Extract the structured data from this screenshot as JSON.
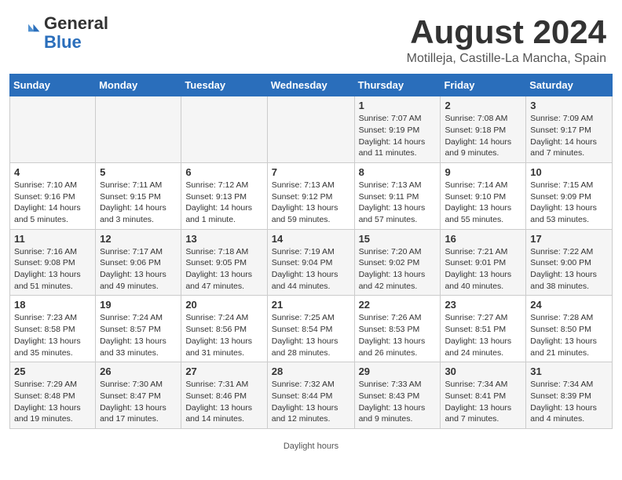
{
  "header": {
    "logo_general": "General",
    "logo_blue": "Blue",
    "month_title": "August 2024",
    "location": "Motilleja, Castille-La Mancha, Spain"
  },
  "days_of_week": [
    "Sunday",
    "Monday",
    "Tuesday",
    "Wednesday",
    "Thursday",
    "Friday",
    "Saturday"
  ],
  "weeks": [
    [
      {
        "day": "",
        "info": ""
      },
      {
        "day": "",
        "info": ""
      },
      {
        "day": "",
        "info": ""
      },
      {
        "day": "",
        "info": ""
      },
      {
        "day": "1",
        "info": "Sunrise: 7:07 AM\nSunset: 9:19 PM\nDaylight: 14 hours and 11 minutes."
      },
      {
        "day": "2",
        "info": "Sunrise: 7:08 AM\nSunset: 9:18 PM\nDaylight: 14 hours and 9 minutes."
      },
      {
        "day": "3",
        "info": "Sunrise: 7:09 AM\nSunset: 9:17 PM\nDaylight: 14 hours and 7 minutes."
      }
    ],
    [
      {
        "day": "4",
        "info": "Sunrise: 7:10 AM\nSunset: 9:16 PM\nDaylight: 14 hours and 5 minutes."
      },
      {
        "day": "5",
        "info": "Sunrise: 7:11 AM\nSunset: 9:15 PM\nDaylight: 14 hours and 3 minutes."
      },
      {
        "day": "6",
        "info": "Sunrise: 7:12 AM\nSunset: 9:13 PM\nDaylight: 14 hours and 1 minute."
      },
      {
        "day": "7",
        "info": "Sunrise: 7:13 AM\nSunset: 9:12 PM\nDaylight: 13 hours and 59 minutes."
      },
      {
        "day": "8",
        "info": "Sunrise: 7:13 AM\nSunset: 9:11 PM\nDaylight: 13 hours and 57 minutes."
      },
      {
        "day": "9",
        "info": "Sunrise: 7:14 AM\nSunset: 9:10 PM\nDaylight: 13 hours and 55 minutes."
      },
      {
        "day": "10",
        "info": "Sunrise: 7:15 AM\nSunset: 9:09 PM\nDaylight: 13 hours and 53 minutes."
      }
    ],
    [
      {
        "day": "11",
        "info": "Sunrise: 7:16 AM\nSunset: 9:08 PM\nDaylight: 13 hours and 51 minutes."
      },
      {
        "day": "12",
        "info": "Sunrise: 7:17 AM\nSunset: 9:06 PM\nDaylight: 13 hours and 49 minutes."
      },
      {
        "day": "13",
        "info": "Sunrise: 7:18 AM\nSunset: 9:05 PM\nDaylight: 13 hours and 47 minutes."
      },
      {
        "day": "14",
        "info": "Sunrise: 7:19 AM\nSunset: 9:04 PM\nDaylight: 13 hours and 44 minutes."
      },
      {
        "day": "15",
        "info": "Sunrise: 7:20 AM\nSunset: 9:02 PM\nDaylight: 13 hours and 42 minutes."
      },
      {
        "day": "16",
        "info": "Sunrise: 7:21 AM\nSunset: 9:01 PM\nDaylight: 13 hours and 40 minutes."
      },
      {
        "day": "17",
        "info": "Sunrise: 7:22 AM\nSunset: 9:00 PM\nDaylight: 13 hours and 38 minutes."
      }
    ],
    [
      {
        "day": "18",
        "info": "Sunrise: 7:23 AM\nSunset: 8:58 PM\nDaylight: 13 hours and 35 minutes."
      },
      {
        "day": "19",
        "info": "Sunrise: 7:24 AM\nSunset: 8:57 PM\nDaylight: 13 hours and 33 minutes."
      },
      {
        "day": "20",
        "info": "Sunrise: 7:24 AM\nSunset: 8:56 PM\nDaylight: 13 hours and 31 minutes."
      },
      {
        "day": "21",
        "info": "Sunrise: 7:25 AM\nSunset: 8:54 PM\nDaylight: 13 hours and 28 minutes."
      },
      {
        "day": "22",
        "info": "Sunrise: 7:26 AM\nSunset: 8:53 PM\nDaylight: 13 hours and 26 minutes."
      },
      {
        "day": "23",
        "info": "Sunrise: 7:27 AM\nSunset: 8:51 PM\nDaylight: 13 hours and 24 minutes."
      },
      {
        "day": "24",
        "info": "Sunrise: 7:28 AM\nSunset: 8:50 PM\nDaylight: 13 hours and 21 minutes."
      }
    ],
    [
      {
        "day": "25",
        "info": "Sunrise: 7:29 AM\nSunset: 8:48 PM\nDaylight: 13 hours and 19 minutes."
      },
      {
        "day": "26",
        "info": "Sunrise: 7:30 AM\nSunset: 8:47 PM\nDaylight: 13 hours and 17 minutes."
      },
      {
        "day": "27",
        "info": "Sunrise: 7:31 AM\nSunset: 8:46 PM\nDaylight: 13 hours and 14 minutes."
      },
      {
        "day": "28",
        "info": "Sunrise: 7:32 AM\nSunset: 8:44 PM\nDaylight: 13 hours and 12 minutes."
      },
      {
        "day": "29",
        "info": "Sunrise: 7:33 AM\nSunset: 8:43 PM\nDaylight: 13 hours and 9 minutes."
      },
      {
        "day": "30",
        "info": "Sunrise: 7:34 AM\nSunset: 8:41 PM\nDaylight: 13 hours and 7 minutes."
      },
      {
        "day": "31",
        "info": "Sunrise: 7:34 AM\nSunset: 8:39 PM\nDaylight: 13 hours and 4 minutes."
      }
    ]
  ],
  "footer": {
    "text": "Daylight hours"
  }
}
